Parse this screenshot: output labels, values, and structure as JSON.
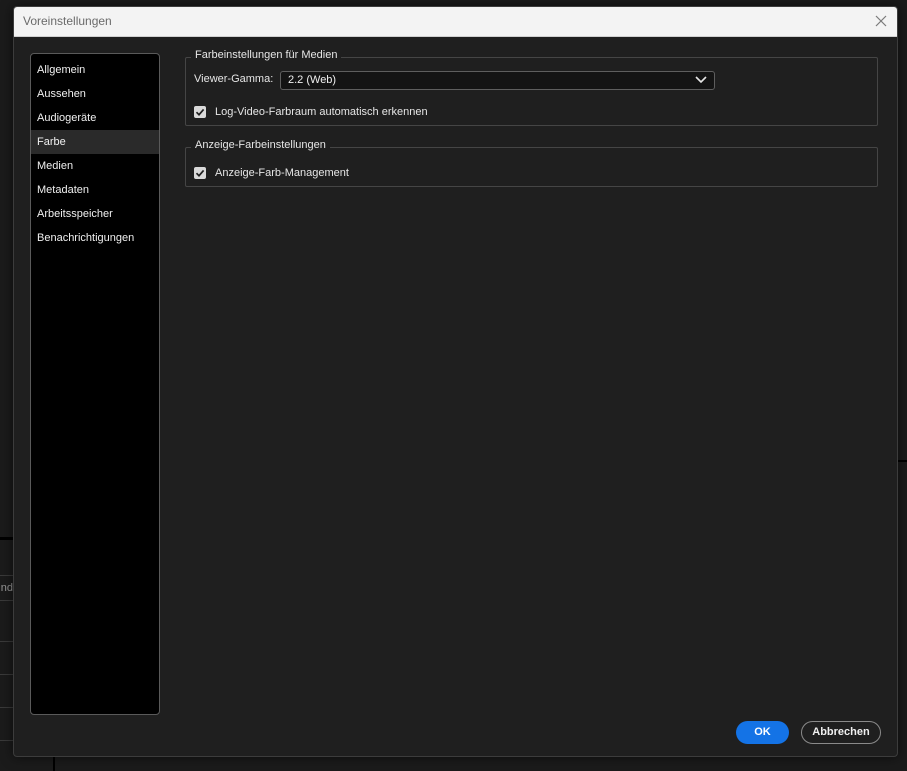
{
  "window": {
    "title": "Voreinstellungen"
  },
  "background": {
    "clipped_text": "nd"
  },
  "sidebar": {
    "items": [
      {
        "label": "Allgemein"
      },
      {
        "label": "Aussehen"
      },
      {
        "label": "Audiogeräte"
      },
      {
        "label": "Farbe",
        "selected": true
      },
      {
        "label": "Medien"
      },
      {
        "label": "Metadaten"
      },
      {
        "label": "Arbeitsspeicher"
      },
      {
        "label": "Benachrichtigungen"
      }
    ]
  },
  "media_color": {
    "legend": "Farbeinstellungen für Medien",
    "gamma_label": "Viewer-Gamma:",
    "gamma_value": "2.2 (Web)",
    "log_checkbox_label": "Log-Video-Farbraum automatisch erkennen",
    "log_checkbox_checked": true
  },
  "display_color": {
    "legend": "Anzeige-Farbeinstellungen",
    "management_label": "Anzeige-Farb-Management",
    "management_checked": true
  },
  "footer": {
    "ok_label": "OK",
    "cancel_label": "Abbrechen"
  },
  "colors": {
    "accent": "#1473e6",
    "dialog_bg": "#1f1f1f",
    "sidebar_bg": "#000000",
    "selected_item_bg": "#2a2a2a"
  },
  "icons": {
    "close": "close-icon",
    "dropdown": "chevron-down-icon",
    "check": "checkmark-icon"
  }
}
